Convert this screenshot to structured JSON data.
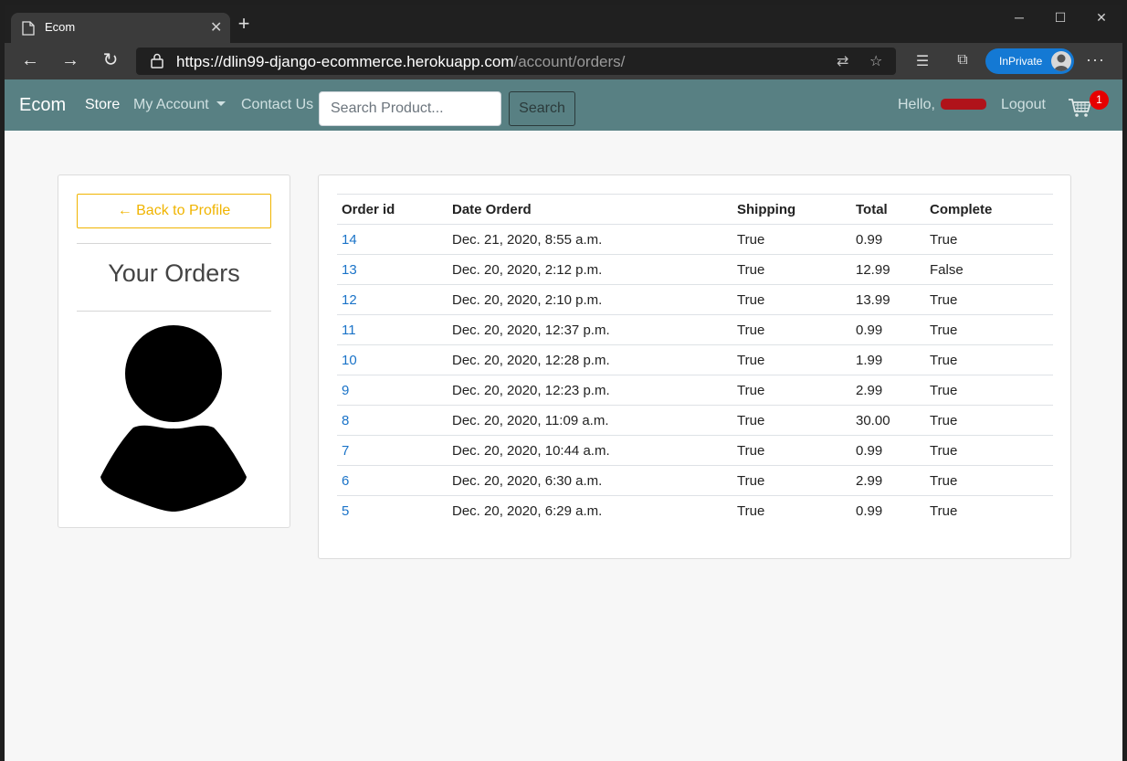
{
  "browser": {
    "tab_title": "Ecom",
    "tab_close": "✕",
    "new_tab": "+",
    "url_host": "https://dlin99-django-ecommerce.herokuapp.com",
    "url_path": "/account/orders/",
    "inprivate_label": "InPrivate",
    "icons": [
      "page-icon",
      "back-arrow-icon",
      "forward-arrow-icon",
      "refresh-icon",
      "lock-icon",
      "translate-icon",
      "star-icon",
      "favorites-icon",
      "collections-icon",
      "profile-avatar-icon",
      "more-icon"
    ]
  },
  "navbar": {
    "brand": "Ecom",
    "store": "Store",
    "my_account": "My Account",
    "contact_us": "Contact Us",
    "search_placeholder": "Search Product...",
    "search_button": "Search",
    "hello": "Hello,",
    "logout": "Logout",
    "cart_count": "1",
    "bg_color": "#588083"
  },
  "sidebar": {
    "back_button": "← Back to Profile",
    "heading": "Your Orders"
  },
  "orders": {
    "headers": [
      "Order id",
      "Date Orderd",
      "Shipping",
      "Total",
      "Complete"
    ],
    "rows": [
      {
        "id": "14",
        "date": "Dec. 21, 2020, 8:55 a.m.",
        "shipping": "True",
        "total": "0.99",
        "complete": "True"
      },
      {
        "id": "13",
        "date": "Dec. 20, 2020, 2:12 p.m.",
        "shipping": "True",
        "total": "12.99",
        "complete": "False"
      },
      {
        "id": "12",
        "date": "Dec. 20, 2020, 2:10 p.m.",
        "shipping": "True",
        "total": "13.99",
        "complete": "True"
      },
      {
        "id": "11",
        "date": "Dec. 20, 2020, 12:37 p.m.",
        "shipping": "True",
        "total": "0.99",
        "complete": "True"
      },
      {
        "id": "10",
        "date": "Dec. 20, 2020, 12:28 p.m.",
        "shipping": "True",
        "total": "1.99",
        "complete": "True"
      },
      {
        "id": "9",
        "date": "Dec. 20, 2020, 12:23 p.m.",
        "shipping": "True",
        "total": "2.99",
        "complete": "True"
      },
      {
        "id": "8",
        "date": "Dec. 20, 2020, 11:09 a.m.",
        "shipping": "True",
        "total": "30.00",
        "complete": "True"
      },
      {
        "id": "7",
        "date": "Dec. 20, 2020, 10:44 a.m.",
        "shipping": "True",
        "total": "0.99",
        "complete": "True"
      },
      {
        "id": "6",
        "date": "Dec. 20, 2020, 6:30 a.m.",
        "shipping": "True",
        "total": "2.99",
        "complete": "True"
      },
      {
        "id": "5",
        "date": "Dec. 20, 2020, 6:29 a.m.",
        "shipping": "True",
        "total": "0.99",
        "complete": "True"
      }
    ]
  }
}
